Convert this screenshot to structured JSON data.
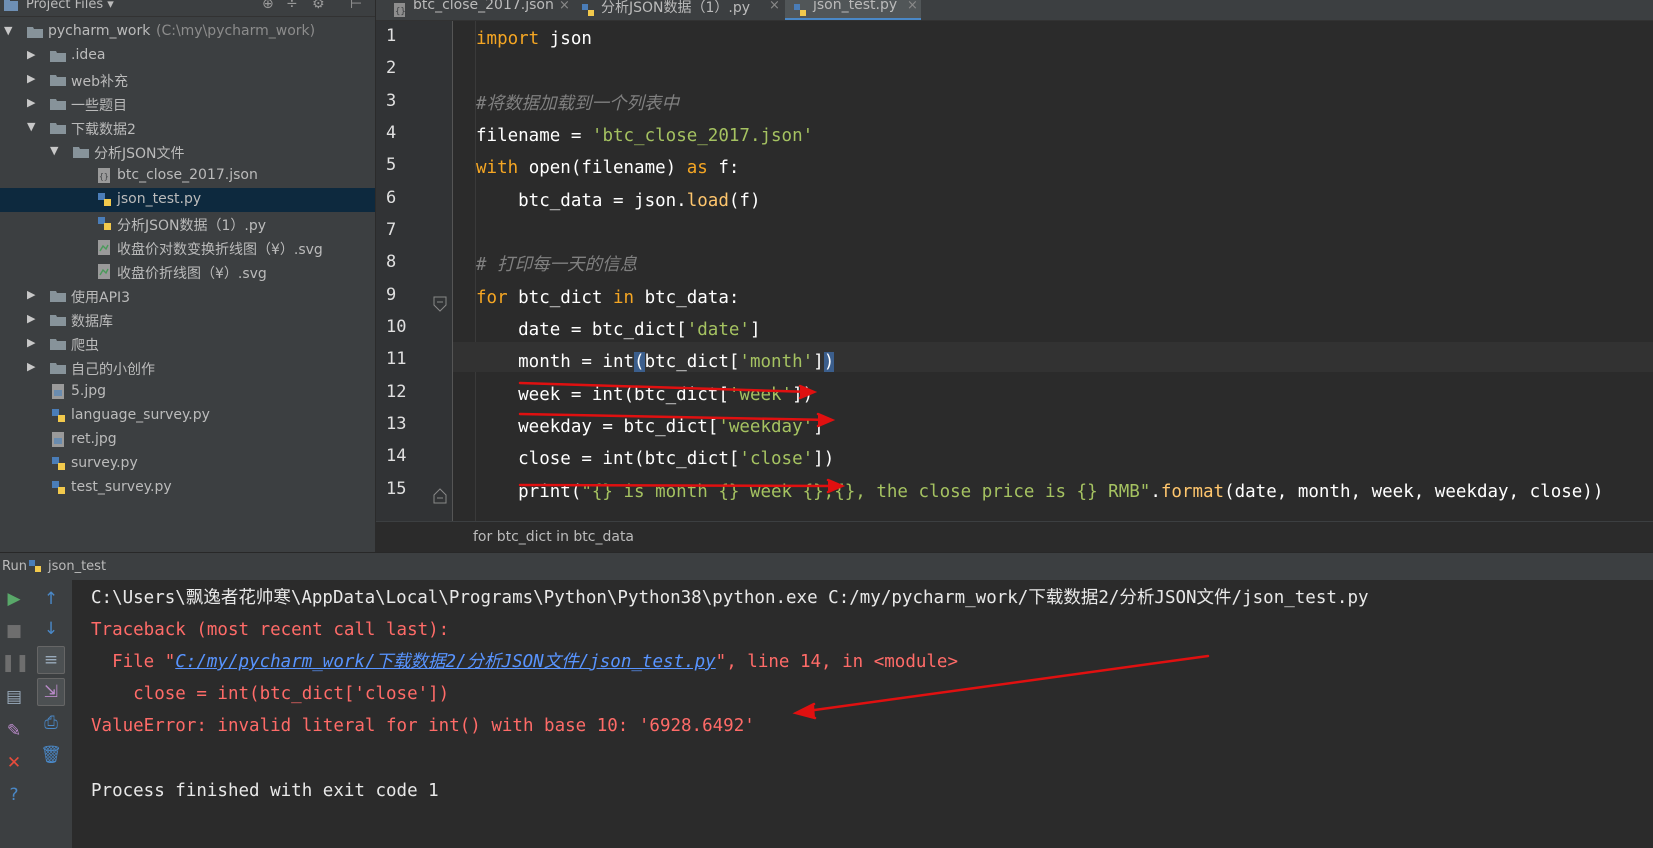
{
  "project_panel": {
    "title": "Project Files",
    "title_arrow": "▾",
    "tools": [
      "⊕",
      "÷",
      "⚙",
      "⊢"
    ],
    "tree": [
      {
        "label": "pycharm_work",
        "path": "(C:\\my\\pycharm_work)",
        "type": "root"
      },
      {
        "label": ".idea",
        "type": "folder"
      },
      {
        "label": "web补充",
        "type": "folder"
      },
      {
        "label": "一些题目",
        "type": "folder"
      },
      {
        "label": "下载数据2",
        "type": "folder"
      },
      {
        "label": "分析JSON文件",
        "type": "folder"
      },
      {
        "label": "btc_close_2017.json",
        "type": "json"
      },
      {
        "label": "json_test.py",
        "type": "py"
      },
      {
        "label": "分析JSON数据（1）.py",
        "type": "py"
      },
      {
        "label": "收盘价对数变换折线图（¥）.svg",
        "type": "svg"
      },
      {
        "label": "收盘价折线图（¥）.svg",
        "type": "svg"
      },
      {
        "label": "使用API3",
        "type": "folder"
      },
      {
        "label": "数据库",
        "type": "folder"
      },
      {
        "label": "爬虫",
        "type": "folder"
      },
      {
        "label": "自己的小创作",
        "type": "folder"
      },
      {
        "label": "5.jpg",
        "type": "file"
      },
      {
        "label": "language_survey.py",
        "type": "py"
      },
      {
        "label": "ret.jpg",
        "type": "file"
      },
      {
        "label": "survey.py",
        "type": "py"
      },
      {
        "label": "test_survey.py",
        "type": "py"
      }
    ]
  },
  "tabs": [
    {
      "label": "btc_close_2017.json",
      "close": "×"
    },
    {
      "label": "分析JSON数据（1）.py",
      "close": "×"
    },
    {
      "label": "json_test.py",
      "close": "×"
    }
  ],
  "line_numbers": [
    "1",
    "2",
    "3",
    "4",
    "5",
    "6",
    "7",
    "8",
    "9",
    "10",
    "11",
    "12",
    "13",
    "14",
    "15"
  ],
  "code": {
    "l1_kw": "import",
    "l1_rest": " json",
    "l3_cm": "#将数据加载到一个列表中",
    "l4_a": "filename = ",
    "l4_str": "'btc_close_2017.json'",
    "l5_kw1": "with",
    "l5_b": " open(filename) ",
    "l5_kw2": "as",
    "l5_c": " f:",
    "l6_a": "    btc_data = json.",
    "l6_fn": "load",
    "l6_b": "(f)",
    "l8_cm": "# 打印每一天的信息",
    "l9_kw1": "for",
    "l9_b": " btc_dict ",
    "l9_kw2": "in",
    "l9_c": " btc_data:",
    "l10_a": "    date = btc_dict[",
    "l10_str": "'date'",
    "l10_b": "]",
    "l11_a": "    month = int",
    "l11_p1": "(",
    "l11_b": "btc_dict[",
    "l11_str": "'month'",
    "l11_c": "]",
    "l11_p2": ")",
    "l12_a": "    week = int(btc_dict[",
    "l12_str": "'week'",
    "l12_b": "])",
    "l13_a": "    weekday = btc_dict[",
    "l13_str": "'weekday'",
    "l13_b": "]",
    "l14_a": "    close = int(btc_dict[",
    "l14_str": "'close'",
    "l14_b": "])",
    "l15_a": "    print(",
    "l15_str": "\"{} is month {} week {},{}, the close price is {} RMB\"",
    "l15_b": ".",
    "l15_fn": "format",
    "l15_c": "(date, month, week, weekday, close))"
  },
  "breadcrumb": "for btc_dict in btc_data",
  "run": {
    "label": "Run",
    "config_name": "json_test"
  },
  "console": {
    "line1": "C:\\Users\\飘逸者花帅寒\\AppData\\Local\\Programs\\Python\\Python38\\python.exe C:/my/pycharm_work/下载数据2/分析JSON文件/json_test.py",
    "line2": "Traceback (most recent call last):",
    "line3_a": "  File \"",
    "line3_link": "C:/my/pycharm_work/下载数据2/分析JSON文件/json_test.py",
    "line3_b": "\", line 14, in <module>",
    "line4": "    close = int(btc_dict['close'])",
    "line5": "ValueError: invalid literal for int() with base 10: '6928.6492'",
    "line7": "Process finished with exit code 1"
  },
  "colors": {
    "annotation_red": "#e01010",
    "keyword": "#f5a623",
    "string": "#a5c261",
    "error": "#ff6b68"
  }
}
